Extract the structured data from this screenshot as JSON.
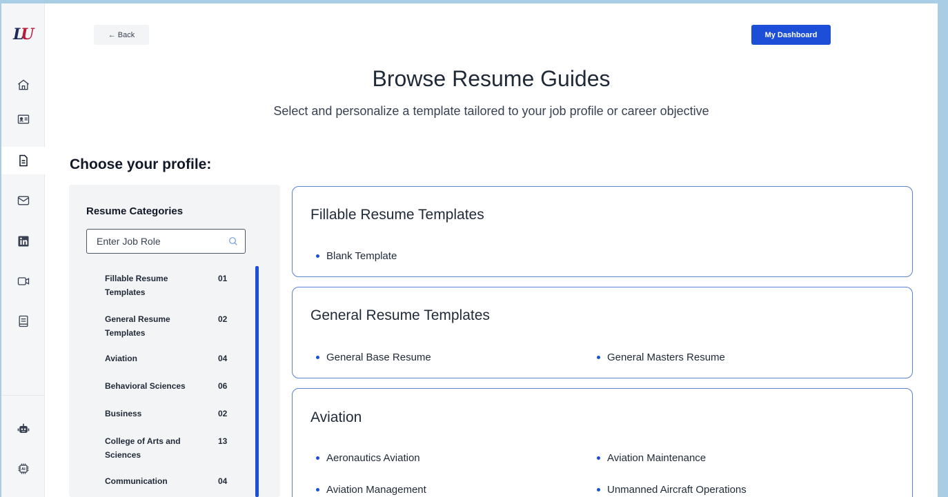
{
  "nav": {
    "logo_text": "LU",
    "icons": [
      "home-icon",
      "id-card-icon",
      "document-icon",
      "mail-icon",
      "linkedin-icon",
      "video-icon",
      "notebook-icon",
      "robot-icon",
      "ai-chip-icon"
    ],
    "active": "document-icon"
  },
  "header": {
    "back_label": "← Back",
    "dashboard_label": "My Dashboard",
    "title": "Browse Resume Guides",
    "subtitle": "Select and personalize a template tailored to your job profile or career objective",
    "choose_profile": "Choose your profile:"
  },
  "categories": {
    "heading": "Resume Categories",
    "search_placeholder": "Enter Job Role",
    "items": [
      {
        "name": "Fillable Resume Templates",
        "count": "01"
      },
      {
        "name": "General Resume Templates",
        "count": "02"
      },
      {
        "name": "Aviation",
        "count": "04"
      },
      {
        "name": "Behavioral Sciences",
        "count": "06"
      },
      {
        "name": "Business",
        "count": "02"
      },
      {
        "name": "College of Arts and Sciences",
        "count": "13"
      },
      {
        "name": "Communication",
        "count": "04"
      }
    ]
  },
  "cards": [
    {
      "title": "Fillable Resume Templates",
      "items": [
        "Blank Template"
      ]
    },
    {
      "title": "General Resume Templates",
      "items": [
        "General Base Resume",
        "General Masters Resume"
      ]
    },
    {
      "title": "Aviation",
      "items": [
        "Aeronautics Aviation",
        "Aviation Maintenance",
        "Aviation Management",
        "Unmanned Aircraft Operations"
      ]
    }
  ],
  "colors": {
    "accent": "#1d4ed8",
    "card_border": "#5b7fd1",
    "logo_red": "#b91c3a",
    "logo_navy": "#1e2a5a",
    "panel_bg": "#f3f4f6"
  }
}
